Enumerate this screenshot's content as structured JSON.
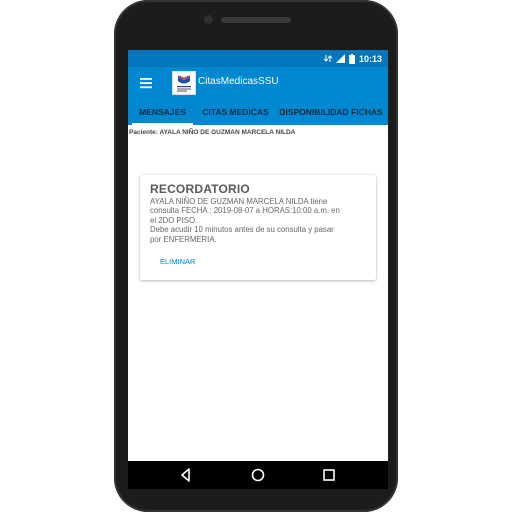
{
  "statusbar": {
    "time": "10:13",
    "icons": [
      "data-sync-icon",
      "signal-icon",
      "battery-icon"
    ]
  },
  "appbar": {
    "title": "CitasMedicasSSU",
    "menu_icon": "hamburger-menu-icon",
    "logo": "app-logo"
  },
  "tabs": [
    {
      "label": "MENSAJES",
      "active": true
    },
    {
      "label": "CITAS MEDICAS",
      "active": false
    },
    {
      "label": "DISPONIBILIDAD FICHAS",
      "active": false
    }
  ],
  "patient_label": "Paciente: AYALA NIÑO DE GUZMAN MARCELA NILDA",
  "card": {
    "title": "RECORDATORIO",
    "lines": [
      "AYALA NIÑO DE GUZMAN MARCELA NILDA tiene",
      "consulta FECHA : 2019-08-07 a HORAS:10:00 a.m. en",
      "el 2DO PISO.",
      "Debe acudir 10 minutos antes de su consulta y pasar",
      "por ENFERMERIA."
    ],
    "button_label": "ELIMINAR"
  },
  "navbar": {
    "icons": [
      "back-icon",
      "home-icon",
      "recent-apps-icon"
    ]
  },
  "colors": {
    "statusbar": "#0277bd",
    "appbar": "#0288d1",
    "accent_button": "#0a84c6",
    "phone_body": "#1c1c1c"
  }
}
